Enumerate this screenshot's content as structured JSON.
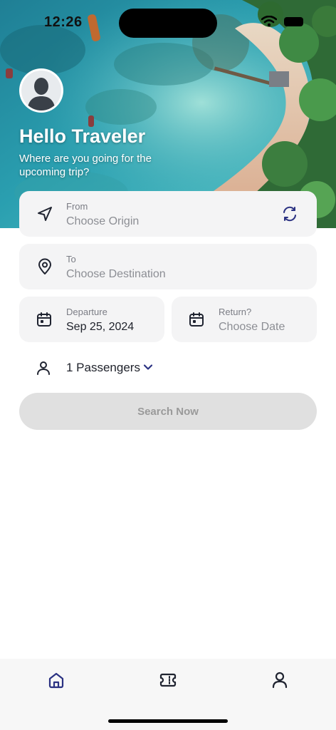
{
  "status_bar": {
    "time": "12:26"
  },
  "header": {
    "greeting": "Hello Traveler",
    "subtitle": "Where are you going for the upcoming trip?",
    "avatar_icon": "person-silhouette-icon"
  },
  "form": {
    "from": {
      "label": "From",
      "placeholder": "Choose Origin",
      "icon": "navigation-arrow-icon"
    },
    "swap_icon": "swap-arrows-icon",
    "to": {
      "label": "To",
      "placeholder": "Choose Destination",
      "icon": "location-pin-icon"
    },
    "departure": {
      "label": "Departure",
      "value": "Sep 25, 2024",
      "icon": "calendar-icon"
    },
    "return": {
      "label": "Return?",
      "placeholder": "Choose Date",
      "icon": "calendar-icon"
    },
    "passengers": {
      "value": "1 Passengers",
      "icon": "person-icon",
      "dropdown_icon": "chevron-down-icon"
    },
    "search_button": "Search Now"
  },
  "bottom_nav": {
    "items": [
      {
        "name": "home",
        "icon": "home-icon",
        "active": true
      },
      {
        "name": "tickets",
        "icon": "ticket-icon",
        "active": false
      },
      {
        "name": "profile",
        "icon": "profile-icon",
        "active": false
      }
    ]
  },
  "colors": {
    "accent": "#2b3282",
    "field_bg": "#f4f4f5",
    "button_disabled_bg": "#e0e0e0",
    "button_disabled_text": "#9a9a9a"
  }
}
